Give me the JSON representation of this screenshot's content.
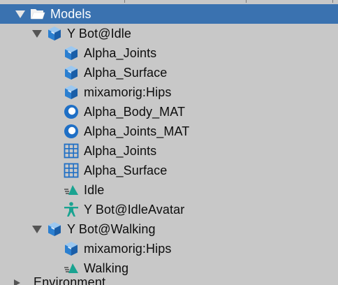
{
  "tree": {
    "root": {
      "label": "Models",
      "icon": "folder-open-icon"
    },
    "prefabs": [
      {
        "label": "Y Bot@Idle",
        "icon": "prefab-cube-icon",
        "children": [
          {
            "label": "Alpha_Joints",
            "icon": "prefab-cube-icon"
          },
          {
            "label": "Alpha_Surface",
            "icon": "prefab-cube-icon"
          },
          {
            "label": "mixamorig:Hips",
            "icon": "prefab-cube-icon"
          },
          {
            "label": "Alpha_Body_MAT",
            "icon": "material-sphere-icon"
          },
          {
            "label": "Alpha_Joints_MAT",
            "icon": "material-sphere-icon"
          },
          {
            "label": "Alpha_Joints",
            "icon": "mesh-grid-icon"
          },
          {
            "label": "Alpha_Surface",
            "icon": "mesh-grid-icon"
          },
          {
            "label": "Idle",
            "icon": "animation-clip-icon"
          },
          {
            "label": "Y Bot@IdleAvatar",
            "icon": "avatar-figure-icon"
          }
        ]
      },
      {
        "label": "Y Bot@Walking",
        "icon": "prefab-cube-icon",
        "children": [
          {
            "label": "mixamorig:Hips",
            "icon": "prefab-cube-icon"
          },
          {
            "label": "Walking",
            "icon": "animation-clip-icon"
          }
        ]
      }
    ],
    "cut_off_next": {
      "label": "Environment"
    }
  },
  "colors": {
    "background": "#c8c8c8",
    "selection": "#3a72b0",
    "icon_blue": "#1f6fc5",
    "icon_teal": "#1aa391"
  }
}
